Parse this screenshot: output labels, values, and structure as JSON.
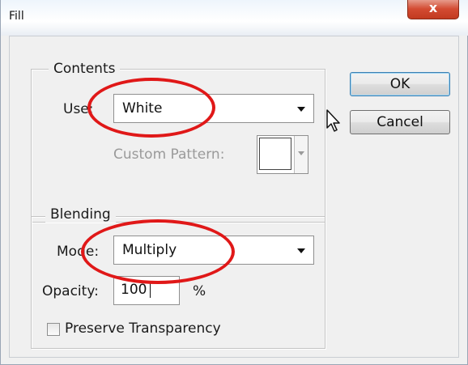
{
  "window": {
    "title": "Fill",
    "close_glyph": "x"
  },
  "contents": {
    "legend": "Contents",
    "use_label": "Use:",
    "use_value": "White",
    "custom_pattern_label": "Custom Pattern:"
  },
  "blending": {
    "legend": "Blending",
    "mode_label": "Mode:",
    "mode_value": "Multiply",
    "opacity_label": "Opacity:",
    "opacity_value": "100",
    "opacity_unit": "%",
    "preserve_label": "Preserve Transparency",
    "preserve_checked": false
  },
  "buttons": {
    "ok": "OK",
    "cancel": "Cancel"
  },
  "colors": {
    "annotation": "#e01818",
    "default_button_border": "#3c7fb1"
  },
  "icons": [
    "close-icon",
    "dropdown-arrow-icon",
    "mouse-pointer-icon"
  ]
}
